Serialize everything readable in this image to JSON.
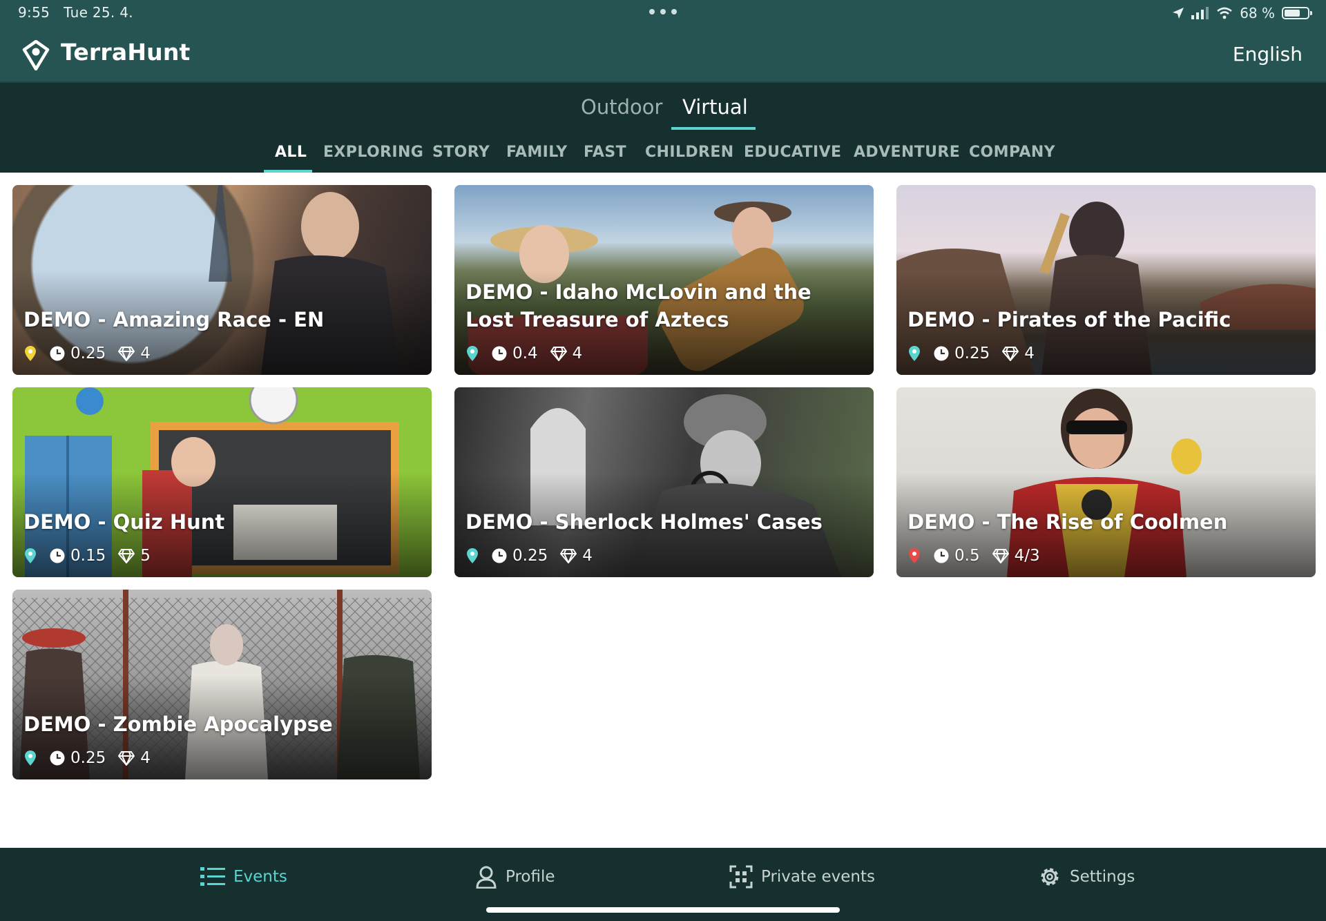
{
  "status_bar": {
    "time": "9:55",
    "date": "Tue 25. 4.",
    "battery_text": "68 %",
    "battery_level": 0.68
  },
  "header": {
    "app_name": "TerraHunt",
    "language": "English"
  },
  "mode_tabs": [
    {
      "label": "Outdoor",
      "active": false
    },
    {
      "label": "Virtual",
      "active": true
    }
  ],
  "categories": [
    {
      "label": "ALL",
      "active": true
    },
    {
      "label": "EXPLORING",
      "active": false
    },
    {
      "label": "STORY",
      "active": false
    },
    {
      "label": "FAMILY",
      "active": false
    },
    {
      "label": "FAST",
      "active": false
    },
    {
      "label": "CHILDREN",
      "active": false
    },
    {
      "label": "EDUCATIVE",
      "active": false
    },
    {
      "label": "ADVENTURE",
      "active": false
    },
    {
      "label": "COMPANY",
      "active": false
    }
  ],
  "events": [
    {
      "title": "DEMO - Amazing Race - EN",
      "duration": "0.25",
      "difficulty": "4",
      "pin_color": "#f2d43a"
    },
    {
      "title": "DEMO - Idaho McLovin and the Lost Treasure of Aztecs",
      "duration": "0.4",
      "difficulty": "4",
      "pin_color": "#5cd4cf"
    },
    {
      "title": "DEMO - Pirates of the Pacific",
      "duration": "0.25",
      "difficulty": "4",
      "pin_color": "#5cd4cf"
    },
    {
      "title": "DEMO - Quiz Hunt",
      "duration": "0.15",
      "difficulty": "5",
      "pin_color": "#5cd4cf"
    },
    {
      "title": "DEMO - Sherlock Holmes' Cases",
      "duration": "0.25",
      "difficulty": "4",
      "pin_color": "#5cd4cf"
    },
    {
      "title": "DEMO - The Rise of Coolmen",
      "duration": "0.5",
      "difficulty": "4/3",
      "pin_color": "#e84a4a"
    },
    {
      "title": "DEMO - Zombie Apocalypse",
      "duration": "0.25",
      "difficulty": "4",
      "pin_color": "#5cd4cf"
    }
  ],
  "bottom_nav": [
    {
      "label": "Events",
      "icon": "list-icon",
      "active": true
    },
    {
      "label": "Profile",
      "icon": "profile-icon",
      "active": false
    },
    {
      "label": "Private events",
      "icon": "qr-icon",
      "active": false
    },
    {
      "label": "Settings",
      "icon": "gear-icon",
      "active": false
    }
  ],
  "colors": {
    "header_bg": "#265452",
    "tabs_bg": "#15302f",
    "accent": "#5cd4cf"
  }
}
